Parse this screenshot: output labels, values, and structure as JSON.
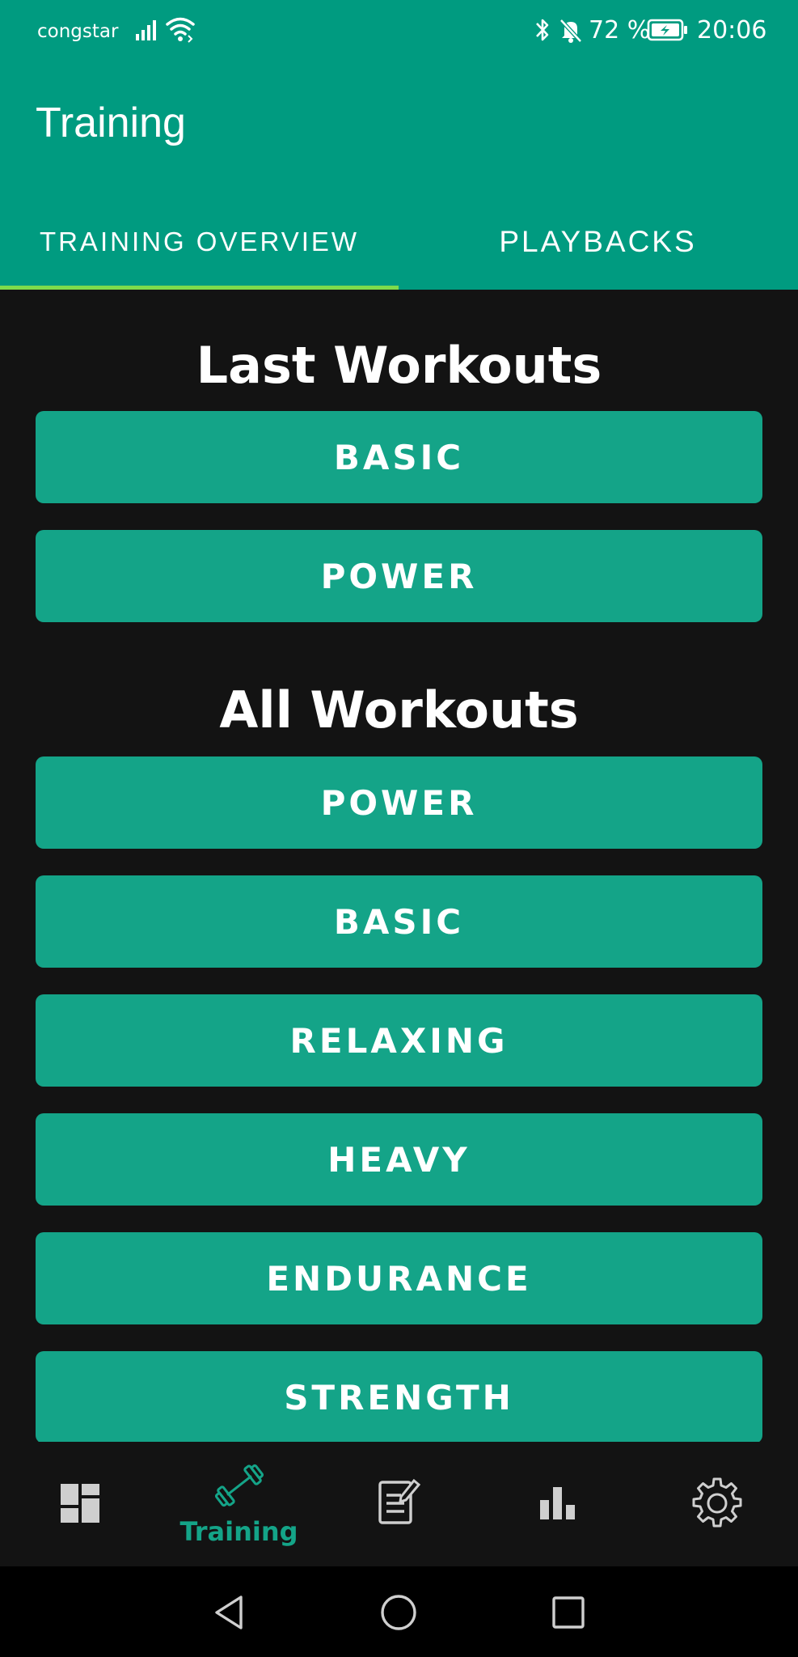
{
  "status_bar": {
    "carrier": "congstar",
    "battery_percent": "72 %",
    "time": "20:06",
    "icons": [
      "signal-icon",
      "wifi-icon",
      "bluetooth-icon",
      "bell-off-icon",
      "battery-charging-icon"
    ]
  },
  "app_bar": {
    "title": "Training"
  },
  "tabs": [
    {
      "label": "TRAINING OVERVIEW",
      "selected": true
    },
    {
      "label": "PLAYBACKS",
      "selected": false
    }
  ],
  "sections": {
    "last_workouts": {
      "title": "Last Workouts",
      "items": [
        "BASIC",
        "POWER"
      ]
    },
    "all_workouts": {
      "title": "All Workouts",
      "items": [
        "POWER",
        "BASIC",
        "RELAXING",
        "HEAVY",
        "ENDURANCE",
        "STRENGTH"
      ]
    }
  },
  "bottom_nav": {
    "items": [
      {
        "icon": "dashboard-icon",
        "label": "",
        "active": false
      },
      {
        "icon": "dumbbell-icon",
        "label": "Training",
        "active": true
      },
      {
        "icon": "notes-edit-icon",
        "label": "",
        "active": false
      },
      {
        "icon": "bar-chart-icon",
        "label": "",
        "active": false
      },
      {
        "icon": "gear-icon",
        "label": "",
        "active": false
      }
    ]
  },
  "system_nav": {
    "icons": [
      "back-icon",
      "home-icon",
      "recents-icon"
    ]
  },
  "colors": {
    "primary": "#009b80",
    "button": "#14a488",
    "tab_indicator": "#7ddb4c",
    "background": "#131313",
    "active_nav": "#14a488"
  }
}
